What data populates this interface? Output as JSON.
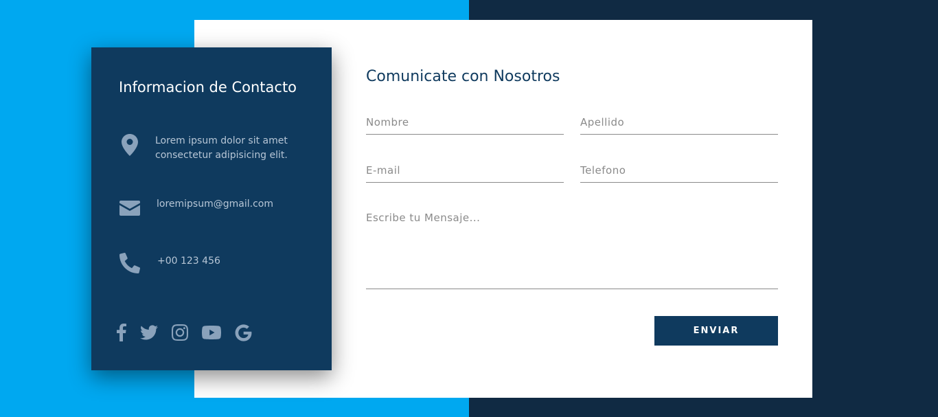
{
  "info": {
    "title": "Informacion de Contacto",
    "address": "Lorem ipsum dolor sit amet consectetur adipisicing elit.",
    "email": "loremipsum@gmail.com",
    "phone": "+00 123 456",
    "socials": [
      "facebook-icon",
      "twitter-icon",
      "instagram-icon",
      "youtube-icon",
      "google-icon"
    ]
  },
  "form": {
    "title": "Comunicate con Nosotros",
    "nombre_placeholder": "Nombre",
    "apellido_placeholder": "Apellido",
    "email_placeholder": "E-mail",
    "telefono_placeholder": "Telefono",
    "mensaje_placeholder": "Escribe tu Mensaje...",
    "submit_label": "ENVIAR"
  },
  "colors": {
    "accent_blue": "#00a8f0",
    "navy": "#0f3a5e",
    "dark_background": "#102a43"
  }
}
